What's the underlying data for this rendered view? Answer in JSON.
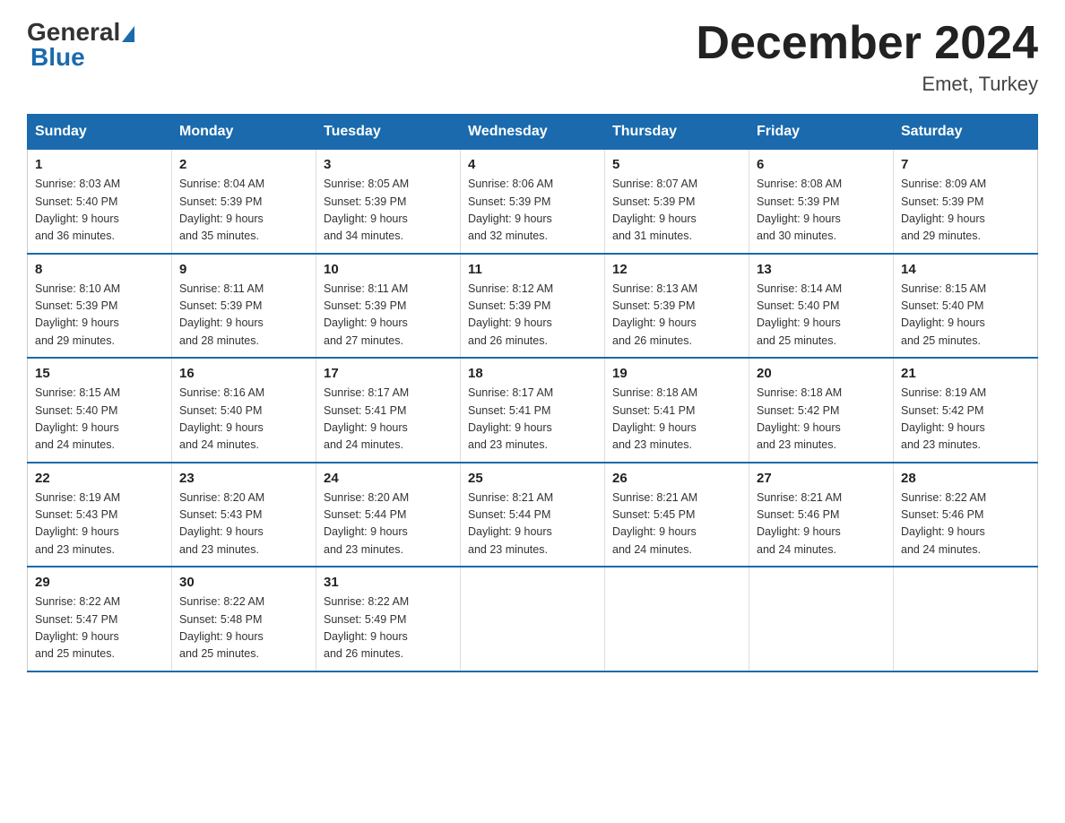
{
  "logo": {
    "general": "General",
    "blue": "Blue"
  },
  "title": "December 2024",
  "subtitle": "Emet, Turkey",
  "days_of_week": [
    "Sunday",
    "Monday",
    "Tuesday",
    "Wednesday",
    "Thursday",
    "Friday",
    "Saturday"
  ],
  "weeks": [
    [
      {
        "day": "1",
        "info": "Sunrise: 8:03 AM\nSunset: 5:40 PM\nDaylight: 9 hours\nand 36 minutes."
      },
      {
        "day": "2",
        "info": "Sunrise: 8:04 AM\nSunset: 5:39 PM\nDaylight: 9 hours\nand 35 minutes."
      },
      {
        "day": "3",
        "info": "Sunrise: 8:05 AM\nSunset: 5:39 PM\nDaylight: 9 hours\nand 34 minutes."
      },
      {
        "day": "4",
        "info": "Sunrise: 8:06 AM\nSunset: 5:39 PM\nDaylight: 9 hours\nand 32 minutes."
      },
      {
        "day": "5",
        "info": "Sunrise: 8:07 AM\nSunset: 5:39 PM\nDaylight: 9 hours\nand 31 minutes."
      },
      {
        "day": "6",
        "info": "Sunrise: 8:08 AM\nSunset: 5:39 PM\nDaylight: 9 hours\nand 30 minutes."
      },
      {
        "day": "7",
        "info": "Sunrise: 8:09 AM\nSunset: 5:39 PM\nDaylight: 9 hours\nand 29 minutes."
      }
    ],
    [
      {
        "day": "8",
        "info": "Sunrise: 8:10 AM\nSunset: 5:39 PM\nDaylight: 9 hours\nand 29 minutes."
      },
      {
        "day": "9",
        "info": "Sunrise: 8:11 AM\nSunset: 5:39 PM\nDaylight: 9 hours\nand 28 minutes."
      },
      {
        "day": "10",
        "info": "Sunrise: 8:11 AM\nSunset: 5:39 PM\nDaylight: 9 hours\nand 27 minutes."
      },
      {
        "day": "11",
        "info": "Sunrise: 8:12 AM\nSunset: 5:39 PM\nDaylight: 9 hours\nand 26 minutes."
      },
      {
        "day": "12",
        "info": "Sunrise: 8:13 AM\nSunset: 5:39 PM\nDaylight: 9 hours\nand 26 minutes."
      },
      {
        "day": "13",
        "info": "Sunrise: 8:14 AM\nSunset: 5:40 PM\nDaylight: 9 hours\nand 25 minutes."
      },
      {
        "day": "14",
        "info": "Sunrise: 8:15 AM\nSunset: 5:40 PM\nDaylight: 9 hours\nand 25 minutes."
      }
    ],
    [
      {
        "day": "15",
        "info": "Sunrise: 8:15 AM\nSunset: 5:40 PM\nDaylight: 9 hours\nand 24 minutes."
      },
      {
        "day": "16",
        "info": "Sunrise: 8:16 AM\nSunset: 5:40 PM\nDaylight: 9 hours\nand 24 minutes."
      },
      {
        "day": "17",
        "info": "Sunrise: 8:17 AM\nSunset: 5:41 PM\nDaylight: 9 hours\nand 24 minutes."
      },
      {
        "day": "18",
        "info": "Sunrise: 8:17 AM\nSunset: 5:41 PM\nDaylight: 9 hours\nand 23 minutes."
      },
      {
        "day": "19",
        "info": "Sunrise: 8:18 AM\nSunset: 5:41 PM\nDaylight: 9 hours\nand 23 minutes."
      },
      {
        "day": "20",
        "info": "Sunrise: 8:18 AM\nSunset: 5:42 PM\nDaylight: 9 hours\nand 23 minutes."
      },
      {
        "day": "21",
        "info": "Sunrise: 8:19 AM\nSunset: 5:42 PM\nDaylight: 9 hours\nand 23 minutes."
      }
    ],
    [
      {
        "day": "22",
        "info": "Sunrise: 8:19 AM\nSunset: 5:43 PM\nDaylight: 9 hours\nand 23 minutes."
      },
      {
        "day": "23",
        "info": "Sunrise: 8:20 AM\nSunset: 5:43 PM\nDaylight: 9 hours\nand 23 minutes."
      },
      {
        "day": "24",
        "info": "Sunrise: 8:20 AM\nSunset: 5:44 PM\nDaylight: 9 hours\nand 23 minutes."
      },
      {
        "day": "25",
        "info": "Sunrise: 8:21 AM\nSunset: 5:44 PM\nDaylight: 9 hours\nand 23 minutes."
      },
      {
        "day": "26",
        "info": "Sunrise: 8:21 AM\nSunset: 5:45 PM\nDaylight: 9 hours\nand 24 minutes."
      },
      {
        "day": "27",
        "info": "Sunrise: 8:21 AM\nSunset: 5:46 PM\nDaylight: 9 hours\nand 24 minutes."
      },
      {
        "day": "28",
        "info": "Sunrise: 8:22 AM\nSunset: 5:46 PM\nDaylight: 9 hours\nand 24 minutes."
      }
    ],
    [
      {
        "day": "29",
        "info": "Sunrise: 8:22 AM\nSunset: 5:47 PM\nDaylight: 9 hours\nand 25 minutes."
      },
      {
        "day": "30",
        "info": "Sunrise: 8:22 AM\nSunset: 5:48 PM\nDaylight: 9 hours\nand 25 minutes."
      },
      {
        "day": "31",
        "info": "Sunrise: 8:22 AM\nSunset: 5:49 PM\nDaylight: 9 hours\nand 26 minutes."
      },
      {
        "day": "",
        "info": ""
      },
      {
        "day": "",
        "info": ""
      },
      {
        "day": "",
        "info": ""
      },
      {
        "day": "",
        "info": ""
      }
    ]
  ]
}
